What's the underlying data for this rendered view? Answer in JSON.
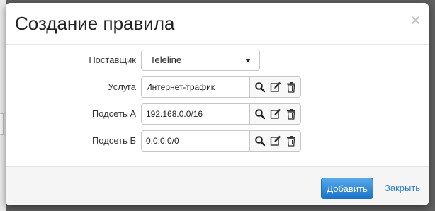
{
  "dialog": {
    "title": "Создание правила",
    "close_label": "×"
  },
  "form": {
    "provider": {
      "label": "Поставщик",
      "value": "Teleline"
    },
    "service": {
      "label": "Услуга",
      "value": "Интернет-трафик"
    },
    "subnet_a": {
      "label": "Подсеть А",
      "value": "192.168.0.0/16"
    },
    "subnet_b": {
      "label": "Подсеть Б",
      "value": "0.0.0.0/0"
    }
  },
  "footer": {
    "add_label": "Добавить",
    "close_label": "Закрыть"
  },
  "icons": {
    "search": "search-icon",
    "edit": "edit-icon",
    "delete": "trash-icon",
    "dropdown": "caret-down-icon"
  },
  "colors": {
    "primary": "#1c74c9",
    "link": "#2c7fcc",
    "overlay": "#5f5f5f"
  }
}
